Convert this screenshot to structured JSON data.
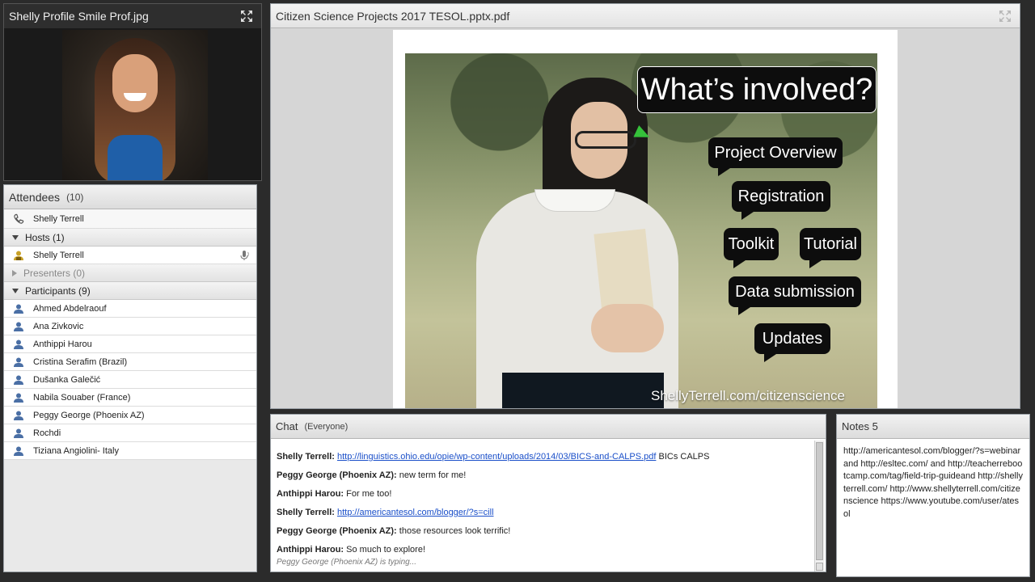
{
  "camera": {
    "title": "Shelly Profile Smile Prof.jpg"
  },
  "attendees": {
    "title": "Attendees",
    "count": "(10)",
    "me": "Shelly Terrell",
    "hosts_label": "Hosts (1)",
    "hosts": [
      "Shelly Terrell"
    ],
    "presenters_label": "Presenters (0)",
    "participants_label": "Participants (9)",
    "participants": [
      "Ahmed Abdelraouf",
      "Ana Zivkovic",
      "Anthippi Harou",
      "Cristina Serafim (Brazil)",
      "Dušanka Galečić",
      "Nabila Souaber (France)",
      "Peggy George (Phoenix AZ)",
      "Rochdi",
      "Tiziana  Angiolini- Italy"
    ]
  },
  "share": {
    "title": "Citizen Science Projects 2017 TESOL.pptx.pdf",
    "slide": {
      "heading": "What’s involved?",
      "bubbles": {
        "overview": "Project Overview",
        "registration": "Registration",
        "toolkit": "Toolkit",
        "tutorial": "Tutorial",
        "data": "Data submission",
        "updates": "Updates"
      },
      "url": "ShellyTerrell.com/citizenscience"
    }
  },
  "chat": {
    "title": "Chat",
    "scope": "(Everyone)",
    "messages": [
      {
        "sender": "Shelly Terrell:",
        "link": "http://linguistics.ohio.edu/opie/wp-content/uploads/2014/03/BICS-and-CALPS.pdf",
        "text": " BICs CALPS"
      },
      {
        "sender": "Peggy George (Phoenix AZ):",
        "link": "",
        "text": " new term for me!"
      },
      {
        "sender": "Anthippi Harou:",
        "link": "",
        "text": " For me too!"
      },
      {
        "sender": "Shelly Terrell:",
        "link": "http://americantesol.com/blogger/?s=cill",
        "text": ""
      },
      {
        "sender": "Peggy George (Phoenix AZ):",
        "link": "",
        "text": " those resources look terrific!"
      },
      {
        "sender": "Anthippi Harou:",
        "link": "",
        "text": " So much to explore!"
      }
    ],
    "typing": "Peggy George (Phoenix AZ) is typing..."
  },
  "notes": {
    "title": "Notes 5",
    "body": "http://americantesol.com/blogger/?s=webinar and http://esltec.com/ and http://teacherrebootcamp.com/tag/field-trip-guideand http://shellyterrell.com/ http://www.shellyterrell.com/citizenscience https://www.youtube.com/user/atesol"
  },
  "colors": {
    "link": "#1a4fc9",
    "slide_bubble": "#0d0d0d",
    "host_icon": "#c9a227",
    "participant_icon": "#4a6fa5"
  }
}
